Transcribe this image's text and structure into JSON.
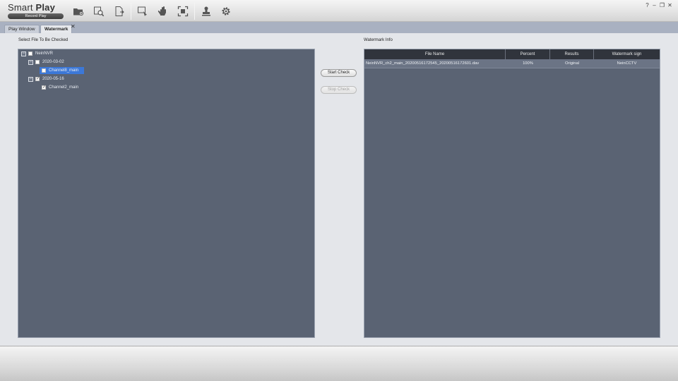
{
  "app": {
    "title_light": "Smart ",
    "title_bold": "Play",
    "subtitle": "Record Play"
  },
  "toolbar": {
    "icons": [
      "open-folder-icon",
      "search-file-icon",
      "export-file-icon",
      "select-area-icon",
      "hand-pan-icon",
      "fullscreen-icon",
      "stamp-icon",
      "settings-gear-icon"
    ]
  },
  "window_controls": {
    "help": "?",
    "minimize": "–",
    "restore": "❐",
    "close": "✕"
  },
  "tabs": [
    {
      "label": "Play Window",
      "active": false
    },
    {
      "label": "Watermark",
      "active": true
    }
  ],
  "tab_close": "✕",
  "left_section": {
    "label": "Select File To Be Checked"
  },
  "tree": [
    {
      "label": "NeinNVR",
      "expander": "−",
      "checked": false,
      "selected": false,
      "level": 0
    },
    {
      "label": "2020-03-02",
      "expander": "−",
      "checked": false,
      "selected": false,
      "level": 1
    },
    {
      "label": "Channel8_main",
      "expander": "",
      "checked": false,
      "selected": true,
      "level": 2
    },
    {
      "label": "2020-05-16",
      "expander": "−",
      "checked": true,
      "selected": false,
      "level": 1
    },
    {
      "label": "Channel2_main",
      "expander": "",
      "checked": true,
      "selected": false,
      "level": 2
    }
  ],
  "buttons": {
    "start_check": "Start Check",
    "stop_check": "Stop Check"
  },
  "right_section": {
    "label": "Watermark Info"
  },
  "table": {
    "columns": [
      "File Name",
      "Percent",
      "Results",
      "Watermark sign"
    ],
    "rows": [
      [
        "NeinNVR_ch2_main_20200516172545_20200516172601.dav",
        "100%",
        "Original",
        "NeinCCTV"
      ]
    ]
  },
  "colors": {
    "panel": "#5a6373",
    "selection": "#3c78d8",
    "table_header": "#30343c"
  }
}
